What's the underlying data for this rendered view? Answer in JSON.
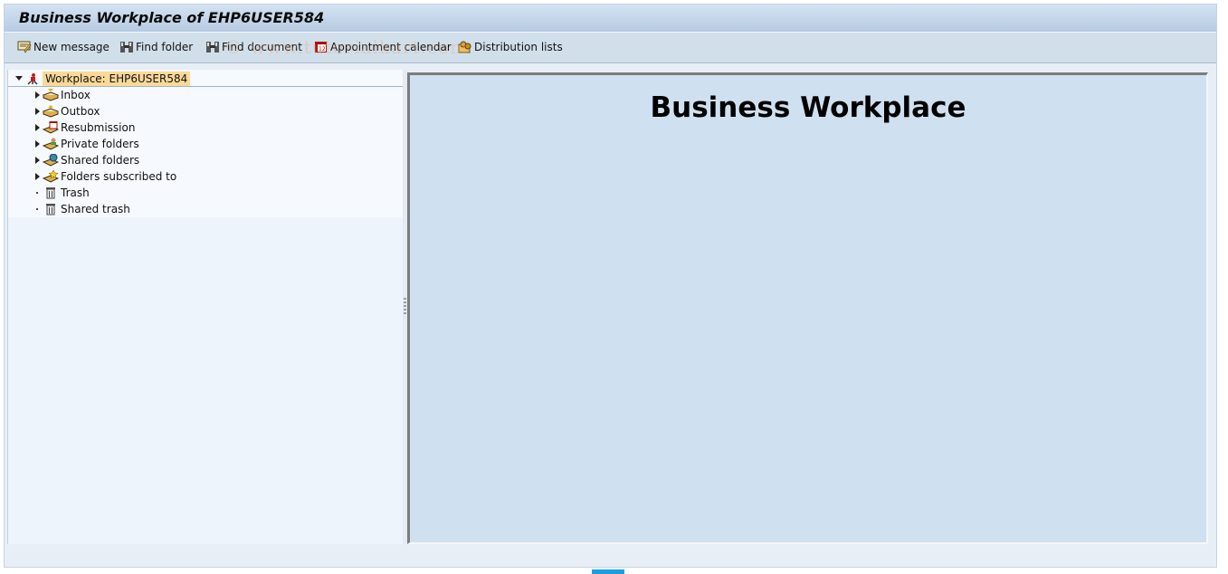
{
  "window": {
    "title": "Business Workplace of EHP6USER584"
  },
  "toolbar": {
    "buttons": [
      {
        "label": "New message",
        "icon": "new-message-icon"
      },
      {
        "label": "Find folder",
        "icon": "binoculars-icon"
      },
      {
        "label": "Find document",
        "icon": "binoculars-icon"
      },
      {
        "label": "Appointment calendar",
        "icon": "calendar-icon"
      },
      {
        "label": "Distribution lists",
        "icon": "distribution-list-icon"
      }
    ]
  },
  "watermark": "© www.tutorialkart.com",
  "tree": {
    "root": {
      "label": "Workplace: EHP6USER584",
      "icon": "workplace-icon",
      "expanded": true
    },
    "items": [
      {
        "label": "Inbox",
        "icon": "inbox-icon",
        "expandable": true
      },
      {
        "label": "Outbox",
        "icon": "outbox-icon",
        "expandable": true
      },
      {
        "label": "Resubmission",
        "icon": "resubmission-icon",
        "expandable": true
      },
      {
        "label": "Private folders",
        "icon": "private-folders-icon",
        "expandable": true
      },
      {
        "label": "Shared folders",
        "icon": "shared-folders-icon",
        "expandable": true
      },
      {
        "label": "Folders subscribed to",
        "icon": "subscribed-folders-icon",
        "expandable": true
      },
      {
        "label": "Trash",
        "icon": "trash-icon",
        "expandable": false
      },
      {
        "label": "Shared trash",
        "icon": "trash-icon",
        "expandable": false
      }
    ]
  },
  "content": {
    "heading": "Business Workplace"
  }
}
